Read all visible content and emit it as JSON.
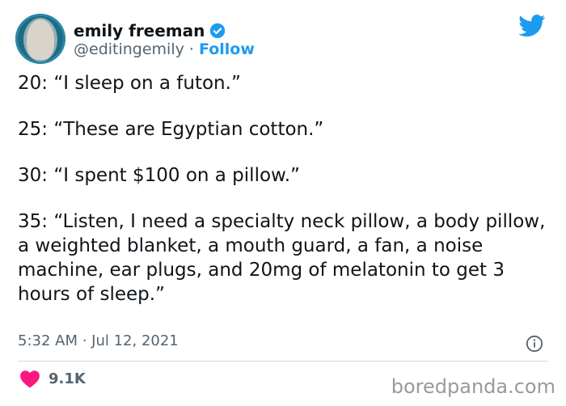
{
  "author": {
    "name": "emily freeman",
    "handle": "@editingemily",
    "separator": "·",
    "follow_label": "Follow"
  },
  "tweet": {
    "lines": [
      "20: “I sleep on a futon.”",
      "25: “These are Egyptian cotton.”",
      "30: “I spent $100 on a pillow.”",
      "35: “Listen, I need a specialty neck pillow, a body pillow, a weighted blanket, a mouth guard, a fan, a noise machine, ear plugs, and 20mg of melatonin to get 3 hours of sleep.”"
    ],
    "timestamp": "5:32 AM · Jul 12, 2021"
  },
  "engagement": {
    "likes": "9.1K"
  },
  "watermark": "boredpanda.com",
  "colors": {
    "twitter_blue": "#1d9bf0",
    "like_red": "#f91880",
    "muted_text": "#536471"
  }
}
